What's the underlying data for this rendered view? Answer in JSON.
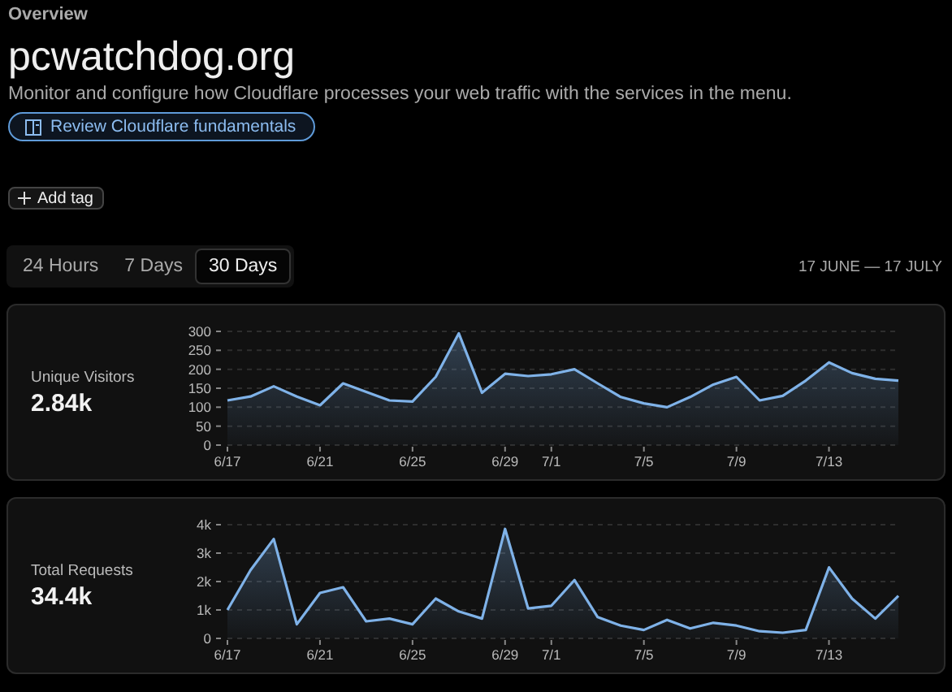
{
  "breadcrumb": "Overview",
  "title": "pcwatchdog.org",
  "description": "Monitor and configure how Cloudflare processes your web traffic with the services in the menu.",
  "fundamentals_button": "Review Cloudflare fundamentals",
  "add_tag_button": "Add tag",
  "tabs": [
    {
      "label": "24 Hours",
      "selected": false
    },
    {
      "label": "7 Days",
      "selected": false
    },
    {
      "label": "30 Days",
      "selected": true
    }
  ],
  "date_range": "17 JUNE — 17 JULY",
  "cards": [
    {
      "label": "Unique Visitors",
      "value": "2.84k",
      "chart_data": {
        "type": "area",
        "grid": true,
        "ylim": [
          0,
          300
        ],
        "categories": [
          "6/17",
          null,
          null,
          null,
          "6/21",
          null,
          null,
          null,
          "6/25",
          null,
          null,
          null,
          "6/29",
          null,
          "7/1",
          null,
          null,
          null,
          "7/5",
          null,
          null,
          null,
          "7/9",
          null,
          null,
          null,
          "7/13",
          null,
          null,
          null
        ],
        "yticks": [
          0,
          50,
          100,
          150,
          200,
          250,
          300
        ],
        "values": [
          118,
          128,
          155,
          128,
          105,
          163,
          140,
          118,
          115,
          180,
          295,
          138,
          188,
          182,
          187,
          200,
          163,
          127,
          110,
          100,
          127,
          160,
          180,
          118,
          130,
          170,
          218,
          190,
          175,
          170
        ]
      }
    },
    {
      "label": "Total Requests",
      "value": "34.4k",
      "chart_data": {
        "type": "area",
        "grid": true,
        "ylim": [
          0,
          4000
        ],
        "categories": [
          "6/17",
          null,
          null,
          null,
          "6/21",
          null,
          null,
          null,
          "6/25",
          null,
          null,
          null,
          "6/29",
          null,
          "7/1",
          null,
          null,
          null,
          "7/5",
          null,
          null,
          null,
          "7/9",
          null,
          null,
          null,
          "7/13",
          null,
          null,
          null
        ],
        "yticks": [
          0,
          {
            "value": 1000,
            "label": "1k"
          },
          {
            "value": 2000,
            "label": "2k"
          },
          {
            "value": 3000,
            "label": "3k"
          },
          {
            "value": 4000,
            "label": "4k"
          }
        ],
        "values": [
          1000,
          2400,
          3500,
          500,
          1600,
          1800,
          600,
          700,
          500,
          1400,
          950,
          700,
          3850,
          1050,
          1150,
          2050,
          750,
          450,
          300,
          650,
          350,
          550,
          450,
          250,
          200,
          300,
          2500,
          1400,
          700,
          1500
        ]
      }
    }
  ]
}
